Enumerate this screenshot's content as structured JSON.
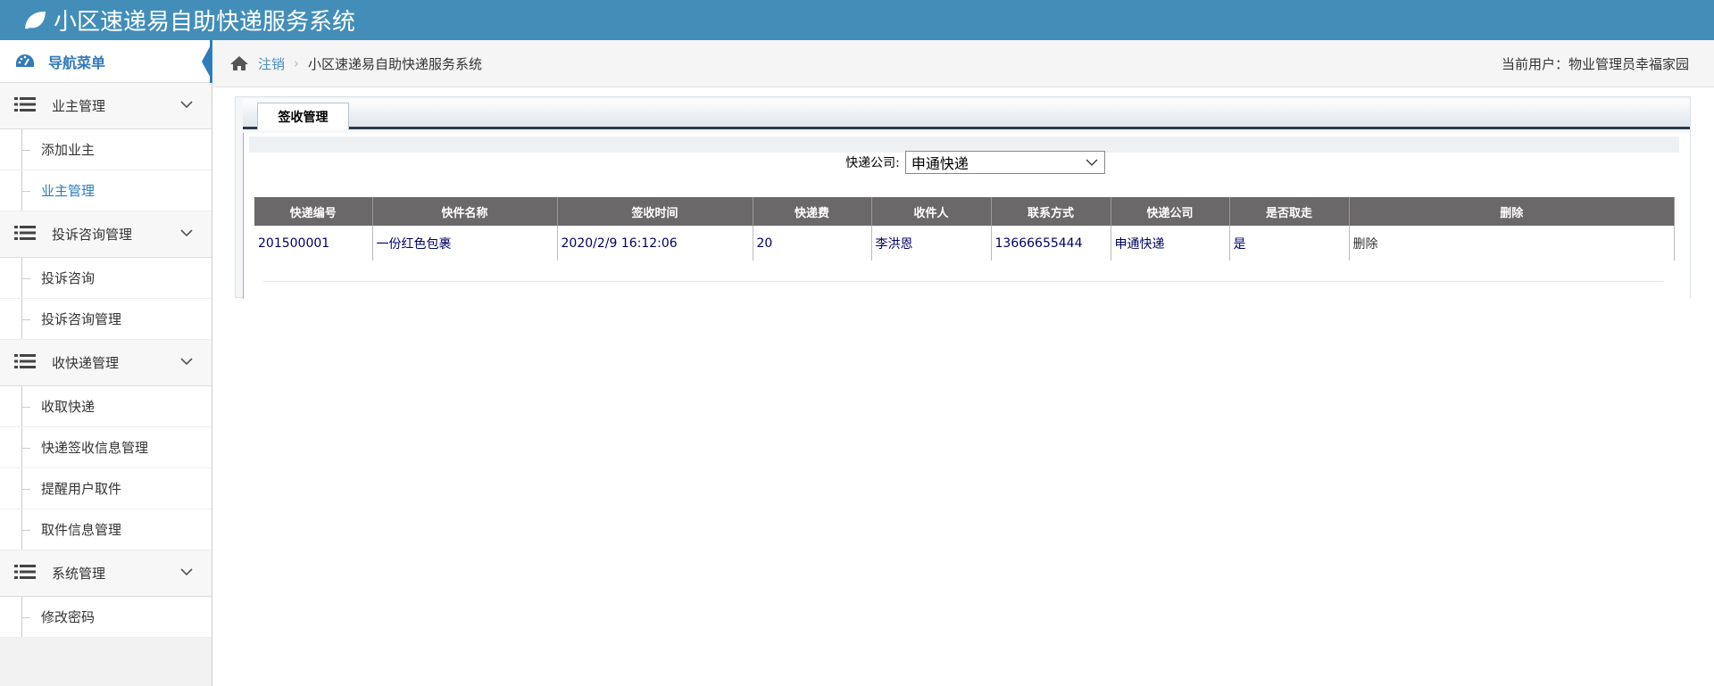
{
  "app": {
    "title": "小区速递易自助快递服务系统"
  },
  "sidebar": {
    "header": "导航菜单",
    "groups": [
      {
        "label": "业主管理",
        "items": [
          "添加业主",
          "业主管理"
        ]
      },
      {
        "label": "投诉咨询管理",
        "items": [
          "投诉咨询",
          "投诉咨询管理"
        ]
      },
      {
        "label": "收快递管理",
        "items": [
          "收取快递",
          "快递签收信息管理",
          "提醒用户取件",
          "取件信息管理"
        ]
      },
      {
        "label": "系统管理",
        "items": [
          "修改密码"
        ]
      }
    ]
  },
  "breadcrumb": {
    "logout": "注销",
    "current": "小区速递易自助快递服务系统",
    "user": "当前用户：物业管理员幸福家园"
  },
  "panel": {
    "tab": "签收管理",
    "filter_label": "快递公司:",
    "filter_value": "申通快递"
  },
  "table": {
    "headers": [
      "快递编号",
      "快件名称",
      "签收时间",
      "快递费",
      "收件人",
      "联系方式",
      "快递公司",
      "是否取走",
      "删除"
    ],
    "rows": [
      [
        "201500001",
        "一份红色包裹",
        "2020/2/9 16:12:06",
        "20",
        "李洪恩",
        "13666655444",
        "申通快递",
        "是",
        "删除"
      ]
    ]
  }
}
